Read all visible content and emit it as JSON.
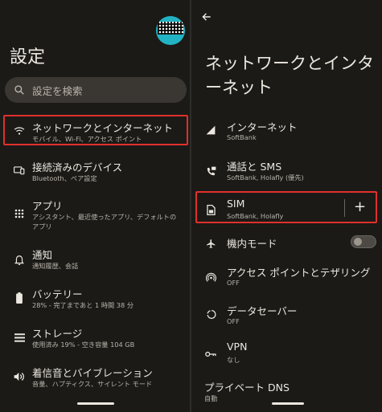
{
  "left": {
    "title": "設定",
    "search_placeholder": "設定を検索",
    "items": [
      {
        "title": "ネットワークとインターネット",
        "subtitle": "モバイル、Wi-Fi、アクセス ポイント",
        "icon": "wifi-icon"
      },
      {
        "title": "接続済みのデバイス",
        "subtitle": "Bluetooth、ペア設定",
        "icon": "devices-icon"
      },
      {
        "title": "アプリ",
        "subtitle": "アシスタント、最近使ったアプリ、デフォルトの",
        "subtitle2": "アプリ",
        "icon": "apps-grid-icon"
      },
      {
        "title": "通知",
        "subtitle": "通知履歴、会話",
        "icon": "bell-icon"
      },
      {
        "title": "バッテリー",
        "subtitle": "28% - 完了まであと 1 時間 38 分",
        "icon": "battery-icon"
      },
      {
        "title": "ストレージ",
        "subtitle": "使用済み 19% - 空き容量 104 GB",
        "icon": "storage-icon"
      },
      {
        "title": "着信音とバイブレーション",
        "subtitle": "音量、ハプティクス、サイレント モード",
        "icon": "volume-icon"
      }
    ]
  },
  "right": {
    "title": "ネットワークとインターネット",
    "items": [
      {
        "title": "インターネット",
        "subtitle": "SoftBank",
        "icon": "signal-icon"
      },
      {
        "title": "通話と SMS",
        "subtitle": "SoftBank, Holafly (優先)",
        "icon": "call-sms-icon"
      },
      {
        "title": "SIM",
        "subtitle": "SoftBank, Holafly",
        "icon": "sim-icon"
      },
      {
        "title": "機内モード",
        "subtitle": "",
        "icon": "airplane-icon"
      },
      {
        "title": "アクセス ポイントとテザリング",
        "subtitle": "OFF",
        "icon": "hotspot-icon"
      },
      {
        "title": "データセーバー",
        "subtitle": "OFF",
        "icon": "data-saver-icon"
      },
      {
        "title": "VPN",
        "subtitle": "なし",
        "icon": "vpn-key-icon"
      },
      {
        "title": "プライベート DNS",
        "subtitle": "自動",
        "icon": ""
      }
    ],
    "add_sim": "+",
    "airplane_mode_on": false
  },
  "colors": {
    "highlight": "#e0302c",
    "background": "#1b1a17",
    "search_bg": "#3a3733"
  }
}
